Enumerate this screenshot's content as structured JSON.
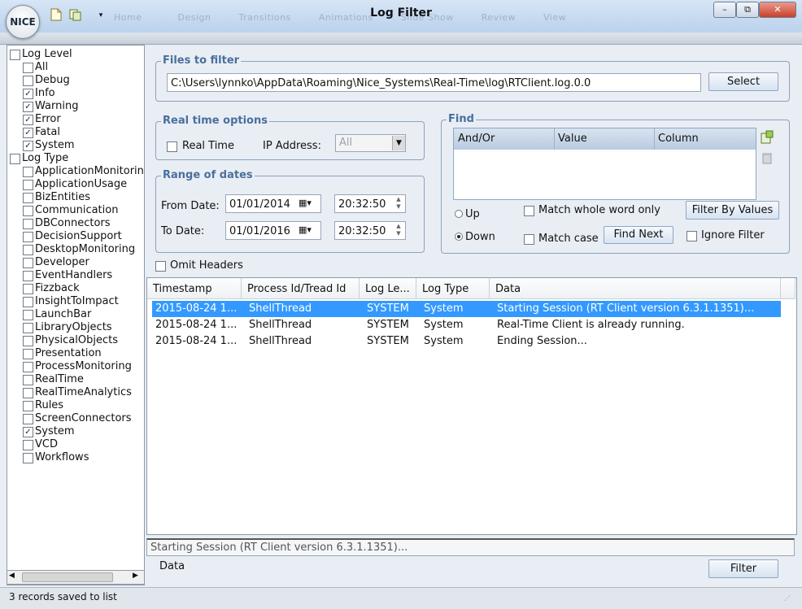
{
  "app": {
    "logo_text": "NICE",
    "title": "Log Filter",
    "ghost_menu": [
      "Home",
      "Design",
      "Transitions",
      "Animations",
      "Slide Show",
      "Review",
      "View"
    ]
  },
  "window_buttons": {
    "minimize": "–",
    "restore": "⧉",
    "close": "✕"
  },
  "tree": {
    "groups": [
      {
        "label": "Log Level",
        "checked": false,
        "items": [
          {
            "label": "All",
            "checked": false
          },
          {
            "label": "Debug",
            "checked": false
          },
          {
            "label": "Info",
            "checked": true
          },
          {
            "label": "Warning",
            "checked": true
          },
          {
            "label": "Error",
            "checked": true
          },
          {
            "label": "Fatal",
            "checked": true
          },
          {
            "label": "System",
            "checked": true
          }
        ]
      },
      {
        "label": "Log Type",
        "checked": false,
        "items": [
          {
            "label": "ApplicationMonitoring",
            "checked": false
          },
          {
            "label": "ApplicationUsage",
            "checked": false
          },
          {
            "label": "BizEntities",
            "checked": false
          },
          {
            "label": "Communication",
            "checked": false
          },
          {
            "label": "DBConnectors",
            "checked": false
          },
          {
            "label": "DecisionSupport",
            "checked": false
          },
          {
            "label": "DesktopMonitoring",
            "checked": false
          },
          {
            "label": "Developer",
            "checked": false
          },
          {
            "label": "EventHandlers",
            "checked": false
          },
          {
            "label": "Fizzback",
            "checked": false
          },
          {
            "label": "InsightToImpact",
            "checked": false
          },
          {
            "label": "LaunchBar",
            "checked": false
          },
          {
            "label": "LibraryObjects",
            "checked": false
          },
          {
            "label": "PhysicalObjects",
            "checked": false
          },
          {
            "label": "Presentation",
            "checked": false
          },
          {
            "label": "ProcessMonitoring",
            "checked": false
          },
          {
            "label": "RealTime",
            "checked": false
          },
          {
            "label": "RealTimeAnalytics",
            "checked": false
          },
          {
            "label": "Rules",
            "checked": false
          },
          {
            "label": "ScreenConnectors",
            "checked": false
          },
          {
            "label": "System",
            "checked": true
          },
          {
            "label": "VCD",
            "checked": false
          },
          {
            "label": "Workflows",
            "checked": false
          }
        ]
      }
    ]
  },
  "files": {
    "title": "Files to filter",
    "path": "C:\\Users\\lynnko\\AppData\\Roaming\\Nice_Systems\\Real-Time\\log\\RTClient.log.0.0",
    "select_label": "Select"
  },
  "realtime": {
    "title": "Real time options",
    "realtime_label": "Real Time",
    "realtime_checked": false,
    "ip_label": "IP Address:",
    "ip_value": "All"
  },
  "dates": {
    "title": "Range of dates",
    "from_label": "From Date:",
    "from_date": "01/01/2014",
    "from_time": "20:32:50",
    "to_label": "To Date:",
    "to_date": "01/01/2016",
    "to_time": "20:32:50"
  },
  "find": {
    "title": "Find",
    "columns": [
      "And/Or",
      "Value",
      "Column"
    ],
    "up_label": "Up",
    "down_label": "Down",
    "direction": "Down",
    "match_whole_label": "Match whole word only",
    "match_case_label": "Match case",
    "filter_by_values_label": "Filter By Values",
    "find_next_label": "Find Next",
    "ignore_filter_label": "Ignore Filter"
  },
  "omit_headers_label": "Omit Headers",
  "grid": {
    "columns": [
      "Timestamp",
      "Process Id/Tread Id",
      "Log Le...",
      "Log Type",
      "Data"
    ],
    "rows": [
      [
        "2015-08-24 1...",
        "ShellThread",
        "SYSTEM",
        "System",
        "Starting Session (RT Client version 6.3.1.1351)..."
      ],
      [
        "2015-08-24 1...",
        "ShellThread",
        "SYSTEM",
        "System",
        "Real-Time Client is already running."
      ],
      [
        "2015-08-24 1...",
        "ShellThread",
        "SYSTEM",
        "System",
        "Ending Session..."
      ]
    ],
    "selected_row": 0
  },
  "detail_text": "Starting Session (RT Client version 6.3.1.1351)...",
  "data_label": "Data",
  "filter_label": "Filter",
  "status_text": "3 records saved to list",
  "icons": {
    "new": "new-document-icon",
    "open": "open-icon",
    "dropdown": "chevron-down-icon",
    "add_find": "add-row-icon",
    "delete_find": "trash-icon",
    "calendar": "calendar-icon"
  },
  "colors": {
    "accent": "#3399ff",
    "group_title": "#4a6f9c"
  }
}
